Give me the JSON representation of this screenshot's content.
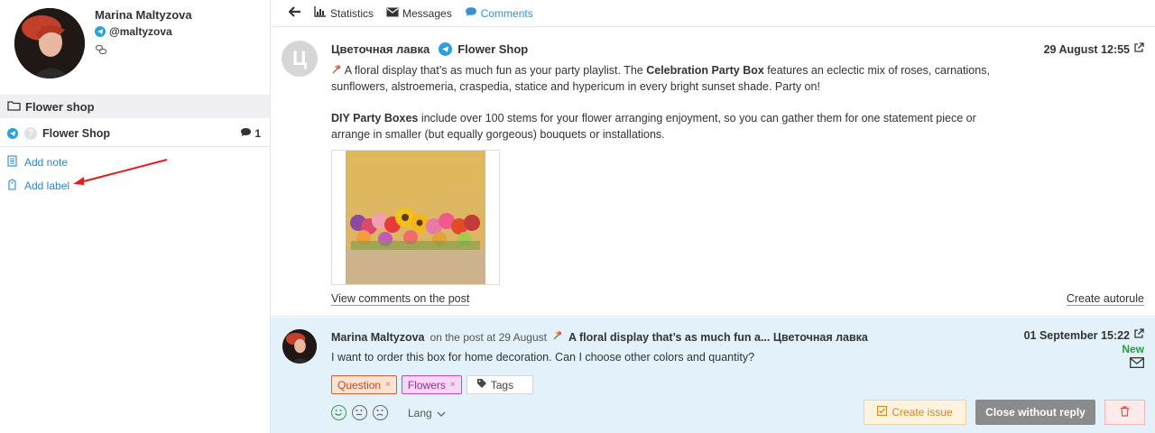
{
  "sidebar": {
    "profile": {
      "name": "Marina Maltyzova",
      "handle": "@maltyzova"
    },
    "group": {
      "title": "Flower shop"
    },
    "channel": {
      "name": "Flower Shop",
      "count": "1"
    },
    "links": {
      "add_note": "Add note",
      "add_label": "Add label"
    }
  },
  "nav": {
    "statistics": "Statistics",
    "messages": "Messages",
    "comments": "Comments"
  },
  "post": {
    "avatar_letter": "Ц",
    "author": "Цветочная лавка",
    "source": "Flower Shop",
    "date": "29 August 12:55",
    "p1_pre": " A floral display that’s as much fun as your party playlist. The ",
    "p1_bold": "Celebration Party Box",
    "p1_post": " features an eclectic mix of roses, carnations, sunflowers, alstroemeria, craspedia, statice and hypericum in every bright sunset shade. Party on!",
    "p2_bold": "DIY Party Boxes",
    "p2_post": " include over 100 stems for your flower arranging enjoyment, so you can gather them for one statement piece or arrange in smaller (but equally gorgeous) bouquets or installations.",
    "view_comments": "View comments on the post",
    "create_autorule": "Create autorule"
  },
  "comment": {
    "author": "Marina Maltyzova",
    "meta": "on the post at 29 August",
    "post_title": "A floral display that’s as much fun a... Цветочная лавка",
    "date": "01 September 15:22",
    "status": "New",
    "text": "I want to order this box for home decoration. Can I choose other colors and quantity?",
    "tags": [
      {
        "label": "Question"
      },
      {
        "label": "Flowers"
      }
    ],
    "tags_button": "Tags",
    "lang": "Lang",
    "create_issue": "Create issue",
    "close_without_reply": "Close without reply"
  },
  "colors": {
    "accent": "#3a8fd6",
    "telegram": "#2aa1da",
    "new_status": "#2b9a3b",
    "comment_bg": "#e3f1fb"
  }
}
